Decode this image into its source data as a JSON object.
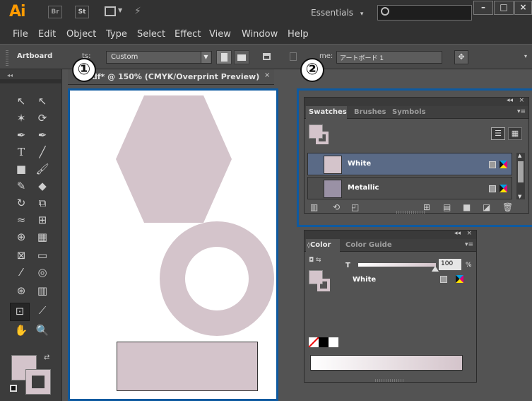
{
  "app": {
    "logo": "Ai",
    "bridge_label": "Br",
    "stock_label": "St",
    "workspace": "Essentials",
    "search_placeholder": "",
    "window_controls": {
      "minimize": "–",
      "maximize": "□",
      "close": "×"
    }
  },
  "menu": [
    "File",
    "Edit",
    "Object",
    "Type",
    "Select",
    "Effect",
    "View",
    "Window",
    "Help"
  ],
  "control_bar": {
    "artboard_label": "Artboard",
    "presets_label": "ts:",
    "preset_value": "Custom",
    "name_label": "me:",
    "name_value": "アートボード 1"
  },
  "document": {
    "tab_title": "pdf* @ 150% (CMYK/Overprint Preview)",
    "tab_close": "×"
  },
  "callouts": {
    "one": "①",
    "two": "②"
  },
  "swatches_panel": {
    "tabs": [
      "Swatches",
      "Brushes",
      "Symbols"
    ],
    "active_tab": "Swatches",
    "swatches": [
      {
        "name": "White",
        "color": "#d4c4cb",
        "selected": true
      },
      {
        "name": "Metallic",
        "color": "#9a91a5",
        "selected": false
      }
    ]
  },
  "color_panel": {
    "tabs": [
      "Color",
      "Color Guide"
    ],
    "active_tab": "Color",
    "slider_label": "T",
    "tint_value": "100",
    "tint_unit": "%",
    "swatch_name": "White"
  },
  "colors": {
    "accent_highlight": "#0e5aa0",
    "shape_fill": "#d4c4cb",
    "logo_orange": "#ff9a00"
  },
  "icons": [
    "search-icon",
    "panel-menu-icon",
    "list-view-icon",
    "grid-view-icon",
    "swatch-libraries-icon",
    "new-color-group-icon",
    "new-swatch-icon",
    "delete-icon"
  ]
}
